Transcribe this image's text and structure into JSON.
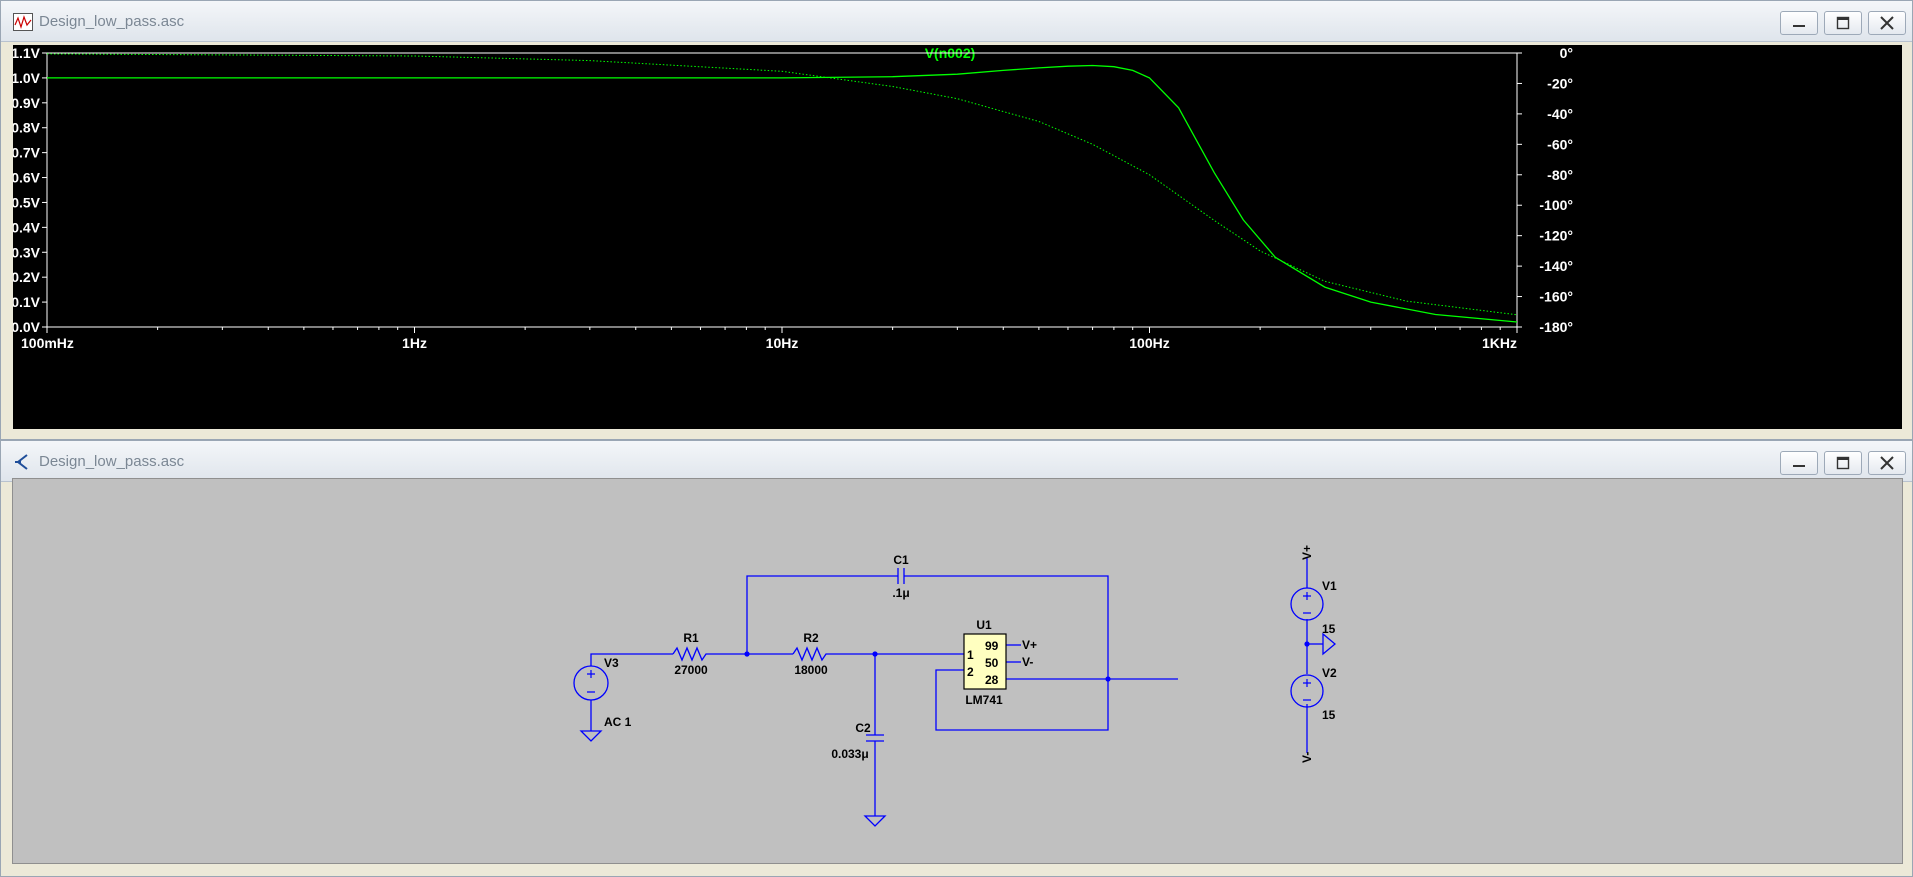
{
  "waveform_window": {
    "title": "Design_low_pass.asc",
    "trace_name": "V(n002)",
    "colors": {
      "trace": "#00ff00",
      "background": "#000000",
      "axis_text": "#ffffff"
    }
  },
  "schematic_window": {
    "title": "Design_low_pass.asc",
    "colors": {
      "wire": "#0000ff",
      "background": "#c0c0c0",
      "opamp_fill": "#ffffc0"
    },
    "labels": {
      "c1_name": "C1",
      "c1_value": ".1μ",
      "r1_name": "R1",
      "r1_value": "27000",
      "r2_name": "R2",
      "r2_value": "18000",
      "c2_name": "C2",
      "c2_value": "0.033μ",
      "v3_name": "V3",
      "v3_value": "AC 1",
      "u1_name": "U1",
      "u1_model": "LM741",
      "pin_1": "1",
      "pin_2": "2",
      "pin_99": "99",
      "pin_50": "50",
      "pin_28": "28",
      "vplus_label": "V+",
      "vminus_label": "V-",
      "v1_name": "V1",
      "v1_value": "15",
      "v2_name": "V2",
      "v2_value": "15",
      "vplus_net": "V+",
      "vminus_net": "V-"
    }
  },
  "window_buttons": {
    "minimize": "minimize-icon",
    "maximize": "maximize-icon",
    "close": "close-icon"
  },
  "chart_data": {
    "type": "line",
    "title": "V(n002)",
    "xlabel": "",
    "ylabel": "",
    "x_scale": "log",
    "x_ticks": [
      "100mHz",
      "1Hz",
      "10Hz",
      "100Hz",
      "1KHz"
    ],
    "y_ticks": [
      "1.1V",
      "1.0V",
      "0.9V",
      "0.8V",
      "0.7V",
      "0.6V",
      "0.5V",
      "0.4V",
      "0.3V",
      "0.2V",
      "0.1V",
      "0.0V"
    ],
    "y2_ticks": [
      "0°",
      "-20°",
      "-40°",
      "-60°",
      "-80°",
      "-100°",
      "-120°",
      "-140°",
      "-160°",
      "-180°"
    ],
    "xlim_hz": [
      0.1,
      1000
    ],
    "ylim": [
      0,
      1.1
    ],
    "y2lim": [
      -180,
      0
    ],
    "grid": false,
    "series": [
      {
        "name": "V(n002)",
        "style": "solid",
        "axis": "left",
        "points": [
          [
            0.1,
            1.0
          ],
          [
            1,
            1.0
          ],
          [
            10,
            1.0
          ],
          [
            20,
            1.005
          ],
          [
            30,
            1.015
          ],
          [
            40,
            1.03
          ],
          [
            50,
            1.04
          ],
          [
            60,
            1.047
          ],
          [
            70,
            1.05
          ],
          [
            80,
            1.045
          ],
          [
            90,
            1.03
          ],
          [
            100,
            1.0
          ],
          [
            120,
            0.88
          ],
          [
            150,
            0.62
          ],
          [
            180,
            0.43
          ],
          [
            220,
            0.28
          ],
          [
            300,
            0.16
          ],
          [
            400,
            0.1
          ],
          [
            600,
            0.05
          ],
          [
            1000,
            0.02
          ]
        ]
      },
      {
        "name": "V(n002)",
        "style": "dotted",
        "axis": "right",
        "points": [
          [
            0.1,
            -0.6
          ],
          [
            1,
            -2
          ],
          [
            3,
            -5
          ],
          [
            10,
            -12
          ],
          [
            20,
            -22
          ],
          [
            30,
            -30
          ],
          [
            50,
            -45
          ],
          [
            70,
            -60
          ],
          [
            100,
            -80
          ],
          [
            150,
            -110
          ],
          [
            200,
            -130
          ],
          [
            300,
            -150
          ],
          [
            500,
            -163
          ],
          [
            1000,
            -172
          ]
        ]
      }
    ]
  }
}
